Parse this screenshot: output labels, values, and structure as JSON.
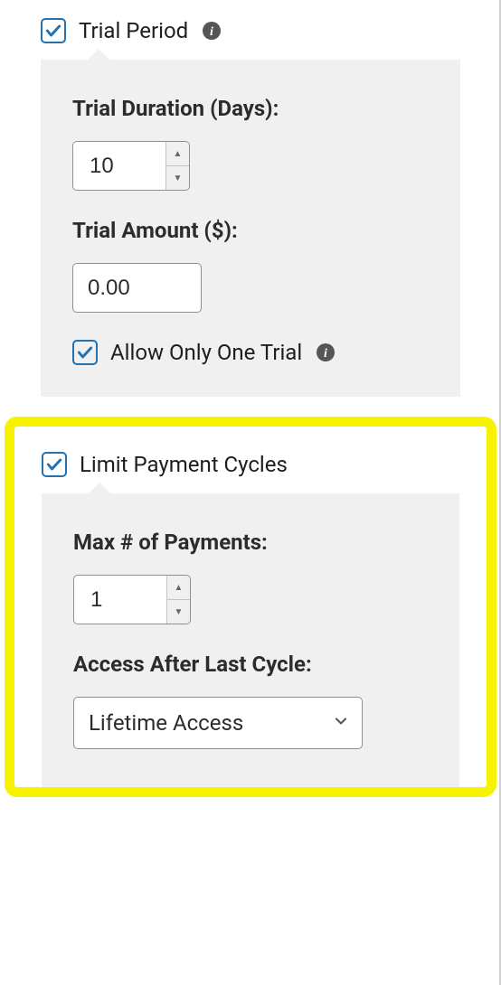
{
  "trial": {
    "checkbox_label": "Trial Period",
    "duration_label": "Trial Duration (Days):",
    "duration_value": "10",
    "amount_label": "Trial Amount ($):",
    "amount_value": "0.00",
    "allow_one_label": "Allow Only One Trial"
  },
  "limit": {
    "checkbox_label": "Limit Payment Cycles",
    "max_label": "Max # of Payments:",
    "max_value": "1",
    "access_label": "Access After Last Cycle:",
    "access_value": "Lifetime Access"
  }
}
